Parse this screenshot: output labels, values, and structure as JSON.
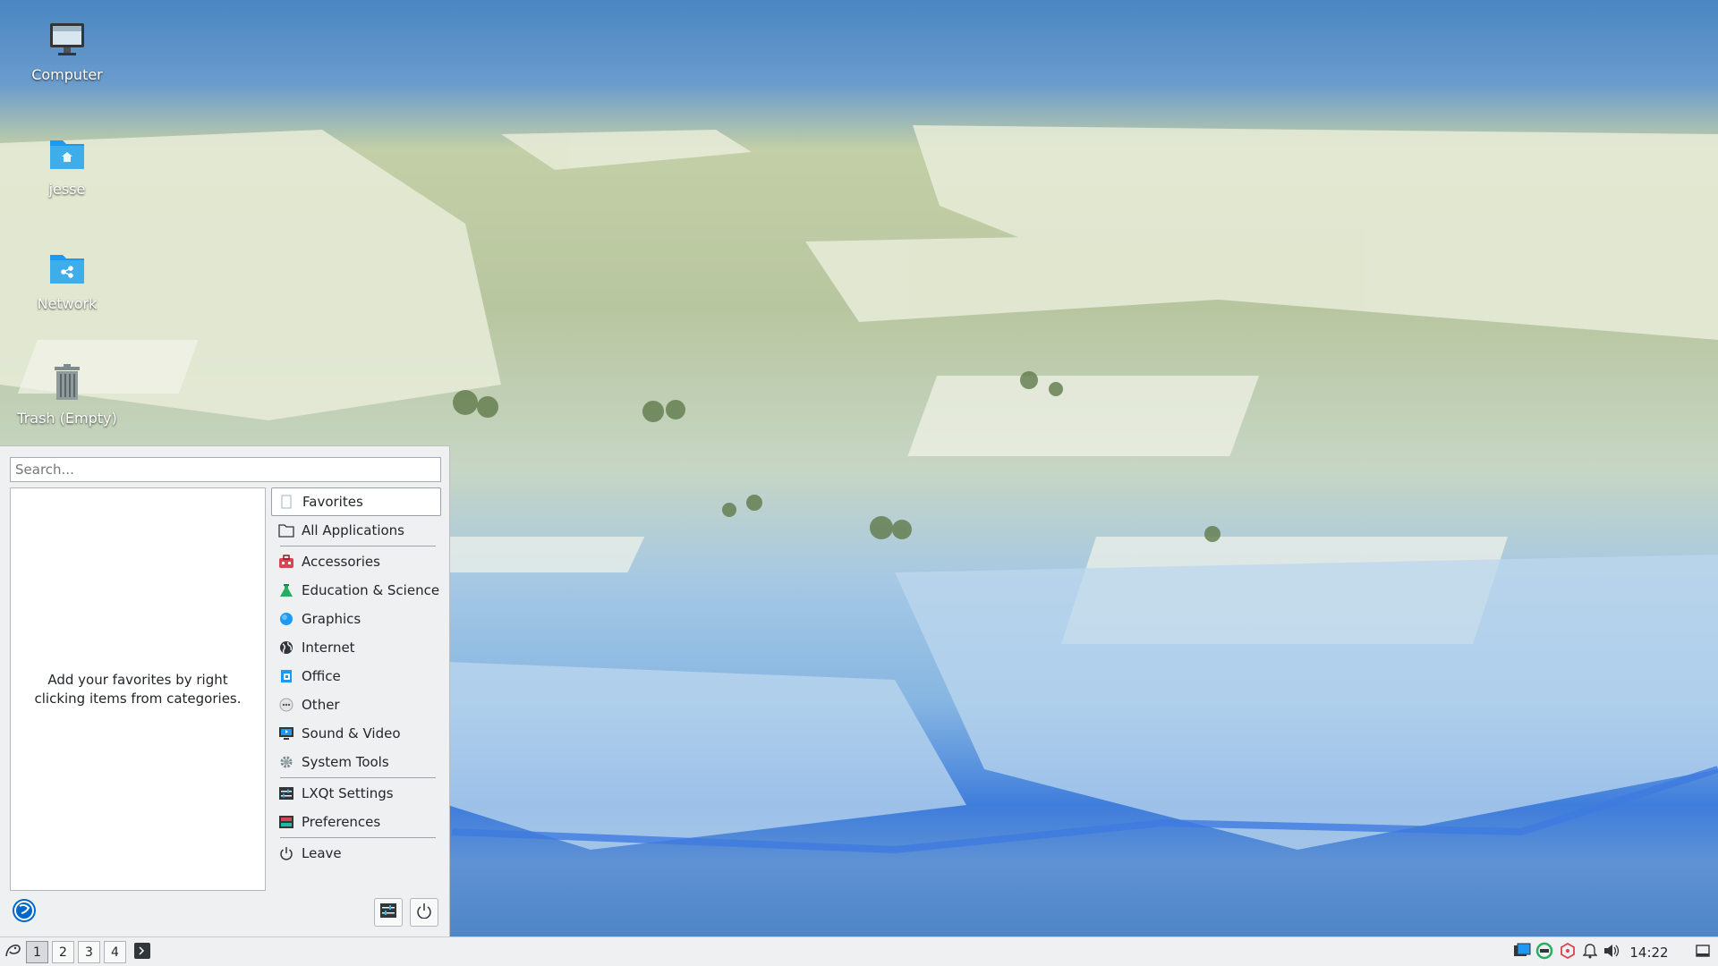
{
  "desktop": {
    "icons": [
      {
        "label": "Computer",
        "icon": "computer-icon"
      },
      {
        "label": "jesse",
        "icon": "home-folder-icon"
      },
      {
        "label": "Network",
        "icon": "network-folder-icon"
      },
      {
        "label": "Trash (Empty)",
        "icon": "trash-icon"
      }
    ]
  },
  "menu": {
    "search_placeholder": "Search...",
    "favorites_hint": "Add your favorites by right clicking items from categories.",
    "categories": [
      {
        "label": "Favorites",
        "icon": "favorites-icon"
      },
      {
        "label": "All Applications",
        "icon": "folder-icon"
      },
      {
        "label": "Accessories",
        "icon": "toolbox-icon"
      },
      {
        "label": "Education & Science",
        "icon": "flask-icon"
      },
      {
        "label": "Graphics",
        "icon": "graphics-icon"
      },
      {
        "label": "Internet",
        "icon": "globe-icon"
      },
      {
        "label": "Office",
        "icon": "office-icon"
      },
      {
        "label": "Other",
        "icon": "other-icon"
      },
      {
        "label": "Sound & Video",
        "icon": "monitor-icon"
      },
      {
        "label": "System Tools",
        "icon": "gear-icon"
      },
      {
        "label": "LXQt Settings",
        "icon": "settings-icon"
      },
      {
        "label": "Preferences",
        "icon": "preferences-icon"
      },
      {
        "label": "Leave",
        "icon": "power-icon"
      }
    ]
  },
  "taskbar": {
    "desktops": [
      "1",
      "2",
      "3",
      "4"
    ],
    "active_desktop": "1",
    "clock": "14:22"
  },
  "colors": {
    "panel_bg": "#eff0f1",
    "folder_blue": "#3daee9",
    "accent": "#3daee9"
  }
}
